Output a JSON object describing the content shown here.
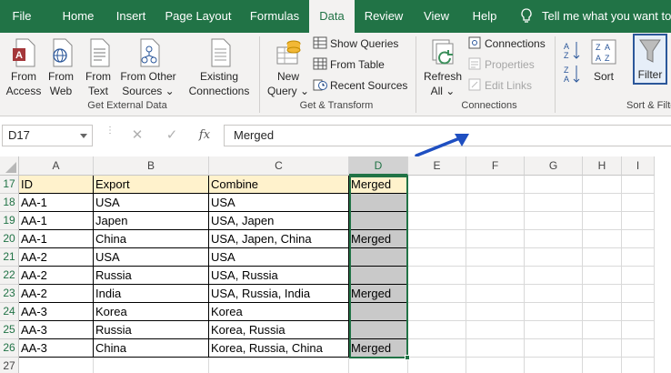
{
  "tabs": [
    "File",
    "Home",
    "Insert",
    "Page Layout",
    "Formulas",
    "Data",
    "Review",
    "View",
    "Help"
  ],
  "tell_me": "Tell me what you want to do",
  "ribbon": {
    "get_external": {
      "from_access": [
        "From",
        "Access"
      ],
      "from_web": [
        "From",
        "Web"
      ],
      "from_text": [
        "From",
        "Text"
      ],
      "from_other": [
        "From Other",
        "Sources"
      ],
      "existing": [
        "Existing",
        "Connections"
      ],
      "label": "Get External Data"
    },
    "get_transform": {
      "new_query": [
        "New",
        "Query"
      ],
      "show_queries": "Show Queries",
      "from_table": "From Table",
      "recent_sources": "Recent Sources",
      "label": "Get & Transform"
    },
    "connections": {
      "refresh": [
        "Refresh",
        "All"
      ],
      "connections": "Connections",
      "properties": "Properties",
      "edit_links": "Edit Links",
      "label": "Connections"
    },
    "sort_filter": {
      "sort": "Sort",
      "filter": "Filter",
      "label": "Sort & Filter"
    }
  },
  "formula_bar": {
    "name_box": "D17",
    "fx": "fx",
    "formula": "Merged"
  },
  "columns": [
    "A",
    "B",
    "C",
    "D",
    "E",
    "F",
    "G",
    "H",
    "I"
  ],
  "rows": [
    {
      "num": "17",
      "cells": [
        "ID",
        "Export",
        "Combine",
        "Merged"
      ]
    },
    {
      "num": "18",
      "cells": [
        "AA-1",
        "USA",
        "USA",
        ""
      ]
    },
    {
      "num": "19",
      "cells": [
        "AA-1",
        "Japen",
        "USA, Japen",
        ""
      ]
    },
    {
      "num": "20",
      "cells": [
        "AA-1",
        "China",
        "USA, Japen, China",
        "Merged"
      ]
    },
    {
      "num": "21",
      "cells": [
        "AA-2",
        "USA",
        "USA",
        ""
      ]
    },
    {
      "num": "22",
      "cells": [
        "AA-2",
        "Russia",
        "USA, Russia",
        ""
      ]
    },
    {
      "num": "23",
      "cells": [
        "AA-2",
        "India",
        "USA, Russia, India",
        "Merged"
      ]
    },
    {
      "num": "24",
      "cells": [
        "AA-3",
        "Korea",
        "Korea",
        ""
      ]
    },
    {
      "num": "25",
      "cells": [
        "AA-3",
        "Russia",
        "Korea, Russia",
        ""
      ]
    },
    {
      "num": "26",
      "cells": [
        "AA-3",
        "China",
        "Korea, Russia, China",
        "Merged"
      ]
    },
    {
      "num": "27",
      "cells": [
        "",
        "",
        "",
        ""
      ]
    }
  ],
  "colors": {
    "accent": "#217346",
    "header_fill": "#fff2cc",
    "gray_fill": "#c9c9c9",
    "arrow": "#1f4fc1"
  }
}
